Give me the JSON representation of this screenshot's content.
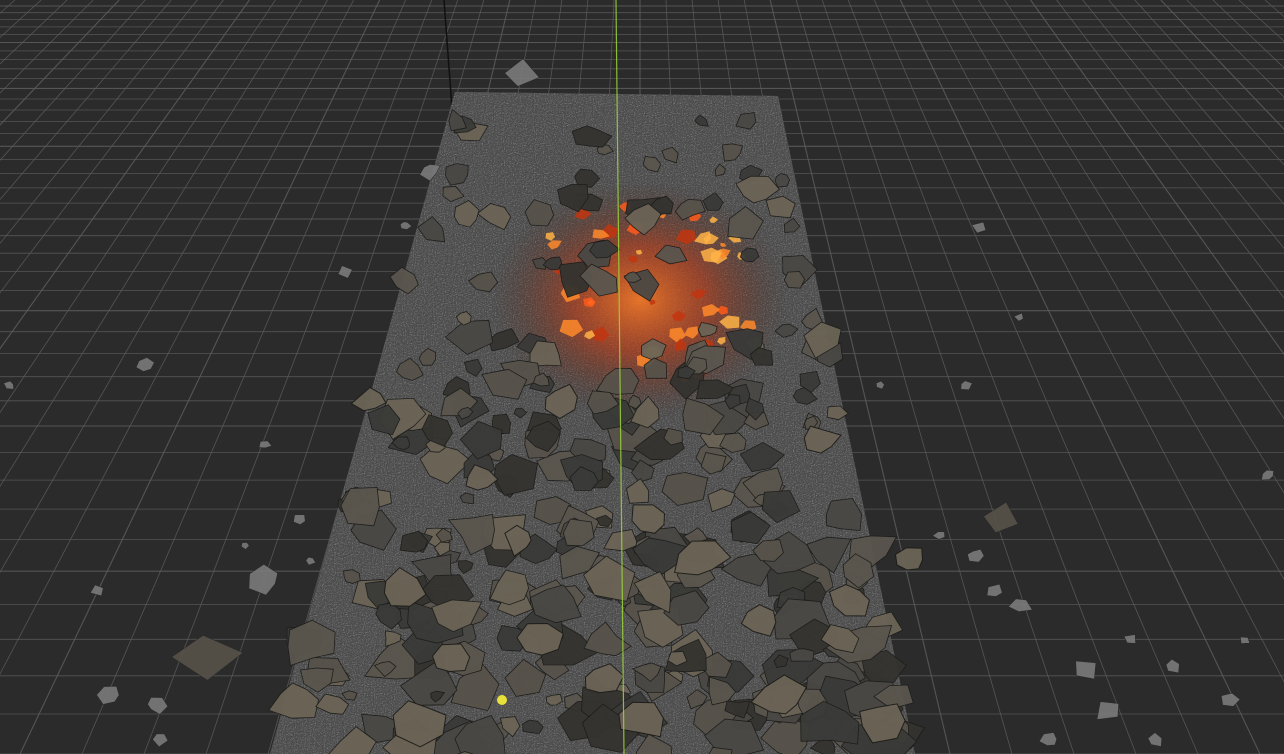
{
  "viewport": {
    "background_color": "#2b2b2b",
    "grid_color": "#5a5a5a",
    "grid_major_color": "#6e6e6e",
    "axis_y_color": "#9cd63a",
    "axis_gizmo_color": "#111111",
    "pivot_color": "#e8e13a"
  },
  "scene": {
    "slab_color": "#4e4e4e",
    "rubble_colors": [
      "#3a3a38",
      "#4a4844",
      "#5a564e",
      "#6b6456",
      "#34332f",
      "#57524a"
    ],
    "ember_colors": [
      "#ff5a1a",
      "#ff8a2a",
      "#c2350f",
      "#ffb347"
    ],
    "shard_color": "#7a7a7a"
  }
}
